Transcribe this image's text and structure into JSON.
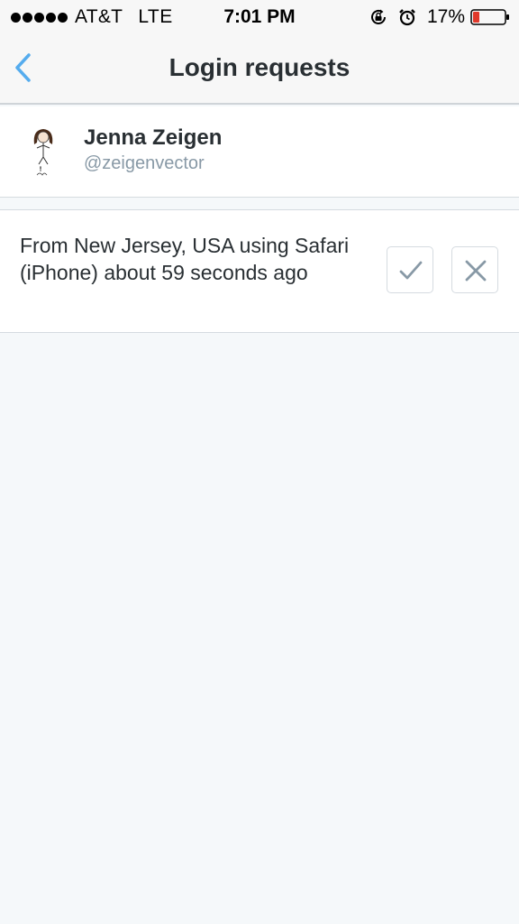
{
  "status_bar": {
    "carrier": "AT&T",
    "network": "LTE",
    "time": "7:01 PM",
    "battery_percent": "17%",
    "icons": [
      "rotation-lock-icon",
      "alarm-icon",
      "battery-icon"
    ]
  },
  "nav": {
    "title": "Login requests",
    "back_icon": "chevron-left-icon"
  },
  "account": {
    "name": "Jenna Zeigen",
    "handle": "@zeigenvector"
  },
  "request": {
    "text": "From New Jersey, USA using Safari (iPhone) about 59 seconds ago",
    "approve_icon": "checkmark-icon",
    "deny_icon": "close-icon"
  },
  "colors": {
    "accent": "#55acee",
    "background": "#f5f8fa",
    "text": "#292f33",
    "muted": "#8899a6",
    "battery_low": "#e0392b"
  }
}
